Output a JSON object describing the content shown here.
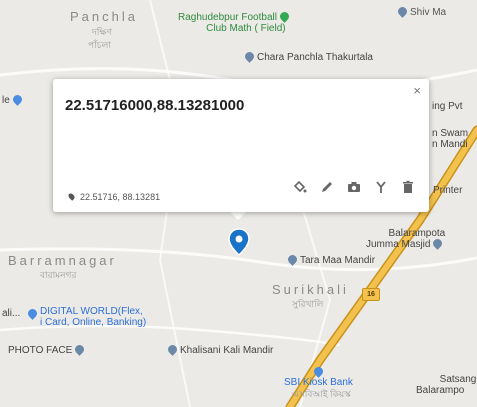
{
  "popup": {
    "coordinates_title": "22.51716000,88.13281000",
    "coordinates_short": "22.51716, 88.13281",
    "close_label": "×",
    "actions": [
      "paint-bucket-icon",
      "pencil-icon",
      "camera-icon",
      "route-fork-icon",
      "trash-icon"
    ]
  },
  "labels": {
    "panchla": "Panchla",
    "panchla_bn1": "দক্ষিণ",
    "panchla_bn2": "পাঁচলা",
    "football_club_line1": "Raghudebpur Football",
    "football_club_line2": "Club Math ( Field)",
    "shiv_mandir": "Shiv Ma",
    "chara_panchla": "Chara Panchla Thakurtala",
    "left_le": "le",
    "ing_pvt": "ing Pvt",
    "swami_line1": "n Swam",
    "swami_line2": "n Mandi",
    "printers": "Printer",
    "balarampota_line1": "Balarampota",
    "balarampota_line2": "Jumma Masjid",
    "barramnagar": "Barramnagar",
    "barramnagar_bn": "বারামনগর",
    "tara_maa": "Tara Maa Mandir",
    "surikhali": "Surikhali",
    "surikhali_bn": "সুরিখালি",
    "road_number": "16",
    "digital_world_prefix": "ali...",
    "digital_world_line1": "DIGITAL WORLD(Flex,",
    "digital_world_line2": "i Card, Online, Banking)",
    "photo_face": "PHOTO FACE",
    "khalisani": "Khalisani Kali Mandir",
    "sbi_kiosk": "SBI Kiosk Bank",
    "sbi_kiosk_bn": "এসবিআই কিয়স্ক",
    "satsang": "Satsang",
    "balarampota_bottom": "Balarampo"
  },
  "colors": {
    "map_background": "#eceae6",
    "highway": "#f2c14e",
    "marker": "#1a73c9"
  }
}
